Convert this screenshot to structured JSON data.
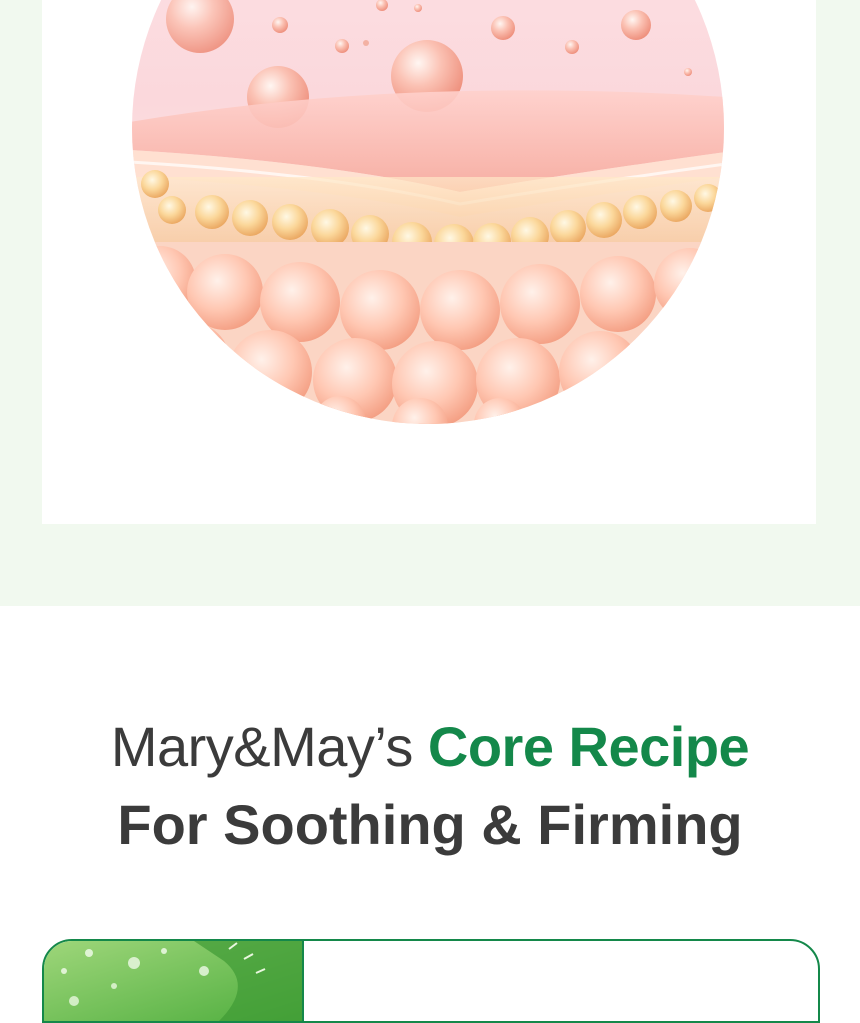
{
  "illustration": {
    "alt_icon": "skin-layers-illustration"
  },
  "headline": {
    "line1_plain": "Mary&May’s ",
    "line1_accent": "Core Recipe",
    "line2": "For Soothing & Firming"
  },
  "ingredient_card": {
    "thumb_icon": "aloe-leaf-image"
  },
  "colors": {
    "accent": "#14884a",
    "text": "#3b3b3b",
    "mint_background": "#f1f9ef"
  }
}
